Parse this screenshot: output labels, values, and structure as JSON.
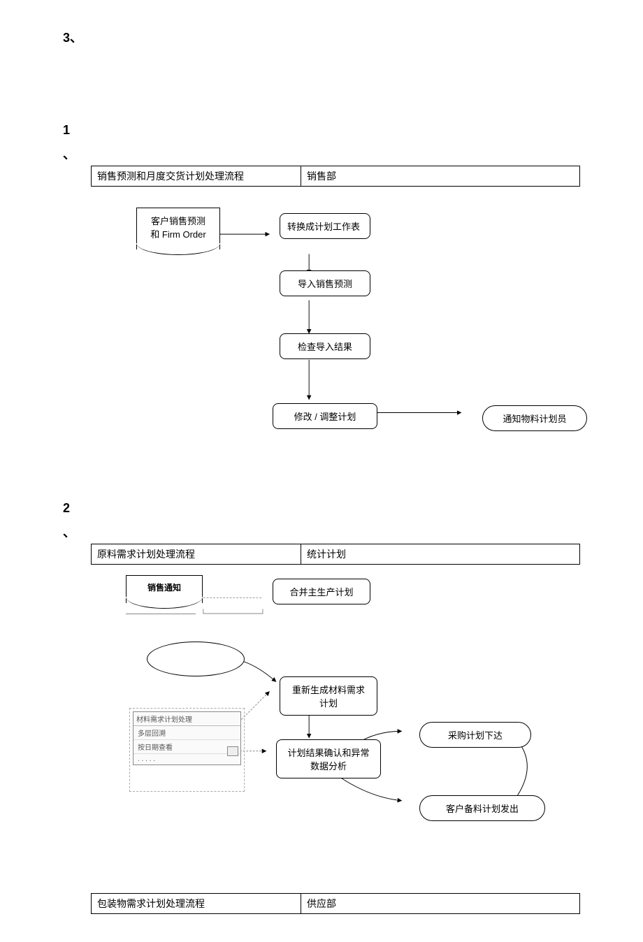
{
  "page_label": "3、",
  "section1": {
    "num": "1",
    "tick": "、",
    "header_left": "销售预测和月度交货计划处理流程",
    "header_right": "销售部",
    "node_doc": "客户销售预测\n和 Firm Order",
    "node_convert": "转换成计划工作表",
    "node_import": "导入销售预测",
    "node_check": "检查导入结果",
    "node_adjust": "修改 / 调整计划",
    "node_notify": "通知物料计划员"
  },
  "section2": {
    "num": "2",
    "tick": "、",
    "header_left": "原料需求计划处理流程",
    "header_right": "统计计划",
    "node_sales_notice": "销售通知",
    "node_merge": "合并主生产计划",
    "node_regen": "重新生成材料需求计划",
    "node_confirm": "计划结果确认和异常数据分析",
    "node_purchase": "采购计划下达",
    "node_customer": "客户备料计划发出",
    "panel_title": "材料需求计划处理",
    "panel_item1": "多层回溯",
    "panel_item2": "按日期查看",
    "panel_item3": ". . . . ."
  },
  "section3": {
    "header_left": "包装物需求计划处理流程",
    "header_right": "供应部"
  },
  "chart_data": [
    {
      "type": "flowchart",
      "title": "销售预测和月度交货计划处理流程",
      "owner": "销售部",
      "nodes": [
        {
          "id": "a",
          "label": "客户销售预测和 Firm Order",
          "shape": "document"
        },
        {
          "id": "b",
          "label": "转换成计划工作表",
          "shape": "rounded"
        },
        {
          "id": "c",
          "label": "导入销售预测",
          "shape": "rounded"
        },
        {
          "id": "d",
          "label": "检查导入结果",
          "shape": "rounded"
        },
        {
          "id": "e",
          "label": "修改 / 调整计划",
          "shape": "rounded"
        },
        {
          "id": "f",
          "label": "通知物料计划员",
          "shape": "terminator"
        }
      ],
      "edges": [
        [
          "a",
          "b"
        ],
        [
          "b",
          "c"
        ],
        [
          "c",
          "d"
        ],
        [
          "d",
          "e"
        ],
        [
          "e",
          "f"
        ]
      ]
    },
    {
      "type": "flowchart",
      "title": "原料需求计划处理流程",
      "owner": "统计计划",
      "nodes": [
        {
          "id": "a",
          "label": "销售通知",
          "shape": "document"
        },
        {
          "id": "b",
          "label": "合并主生产计划",
          "shape": "rounded"
        },
        {
          "id": "c",
          "label": "重新生成材料需求计划",
          "shape": "rounded"
        },
        {
          "id": "d",
          "label": "计划结果确认和异常数据分析",
          "shape": "rounded"
        },
        {
          "id": "e",
          "label": "采购计划下达",
          "shape": "terminator"
        },
        {
          "id": "f",
          "label": "客户备料计划发出",
          "shape": "terminator"
        },
        {
          "id": "g",
          "label": "材料需求计划处理(多层回溯/按日期查看/…)",
          "shape": "ui-panel"
        }
      ],
      "edges": [
        [
          "a",
          "b"
        ],
        [
          "b",
          "c"
        ],
        [
          "c",
          "d"
        ],
        [
          "d",
          "e"
        ],
        [
          "d",
          "f"
        ],
        [
          "g",
          "c"
        ],
        [
          "g",
          "d"
        ]
      ]
    },
    {
      "type": "flowchart",
      "title": "包装物需求计划处理流程",
      "owner": "供应部",
      "nodes": [],
      "edges": []
    }
  ]
}
